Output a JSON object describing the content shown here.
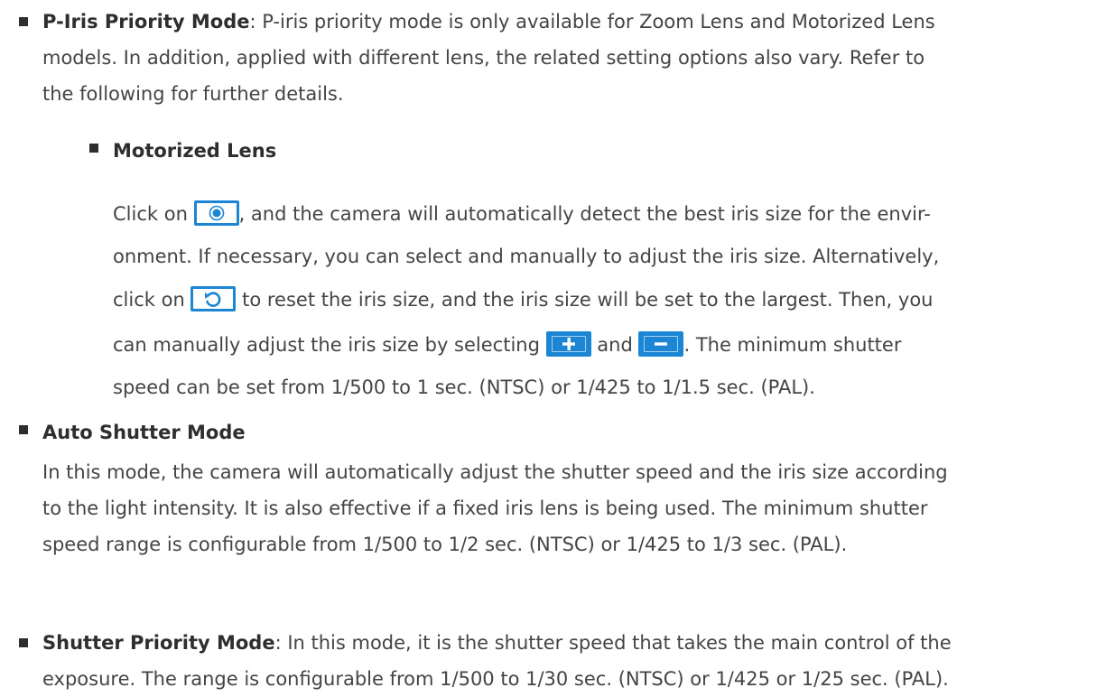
{
  "colors": {
    "accent": "#1c86d4",
    "text": "#444444",
    "bold": "#2e2e2e"
  },
  "piris": {
    "title": "P-Iris Priority Mode",
    "line1": ": P-iris priority mode is only available for Zoom Lens and Motorized Lens",
    "line2": "models. In addition, applied with different lens, the related setting options also vary. Refer to",
    "line3": "the following for further details."
  },
  "motorized": {
    "title": "Motorized Lens",
    "l1a": "Click on ",
    "l1b": ", and the camera will automatically detect the best iris size for the envir-",
    "l2": "onment. If necessary, you can select and manually to adjust the iris size. Alternatively,",
    "l3a": "click on ",
    "l3b": " to reset the iris size, and the iris size will be set to the largest. Then, you",
    "l4a": "can manually adjust the iris size by selecting ",
    "l4b": " and ",
    "l4c": ". The minimum shutter",
    "l5": "speed can be set from 1/500 to 1 sec. (NTSC) or 1/425 to 1/1.5 sec. (PAL).",
    "icons": [
      "auto-iris-icon",
      "reset-icon",
      "plus-icon",
      "minus-icon"
    ]
  },
  "auto_shutter": {
    "title": "Auto Shutter Mode",
    "line1": "In this mode, the camera will automatically adjust the shutter speed and the iris size according",
    "line2": "to the light intensity. It is also effective if a fixed iris lens is being used. The minimum shutter",
    "line3": "speed range is configurable from 1/500 to 1/2 sec. (NTSC) or 1/425 to 1/3 sec. (PAL)."
  },
  "shutter_priority": {
    "title": "Shutter Priority Mode",
    "line1": ": In this mode, it is the shutter speed that takes the main control of the",
    "line2": "exposure. The range is configurable from 1/500 to 1/30 sec. (NTSC) or 1/425 or 1/25 sec. (PAL)."
  }
}
